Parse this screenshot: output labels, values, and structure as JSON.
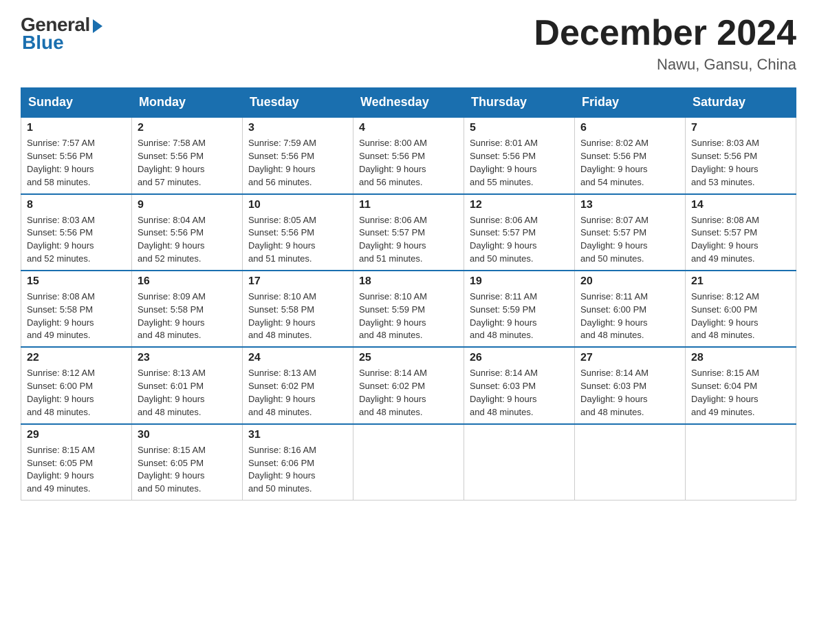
{
  "logo": {
    "general": "General",
    "blue": "Blue"
  },
  "header": {
    "title": "December 2024",
    "location": "Nawu, Gansu, China"
  },
  "weekdays": [
    "Sunday",
    "Monday",
    "Tuesday",
    "Wednesday",
    "Thursday",
    "Friday",
    "Saturday"
  ],
  "weeks": [
    [
      {
        "day": "1",
        "sunrise": "7:57 AM",
        "sunset": "5:56 PM",
        "daylight": "9 hours and 58 minutes."
      },
      {
        "day": "2",
        "sunrise": "7:58 AM",
        "sunset": "5:56 PM",
        "daylight": "9 hours and 57 minutes."
      },
      {
        "day": "3",
        "sunrise": "7:59 AM",
        "sunset": "5:56 PM",
        "daylight": "9 hours and 56 minutes."
      },
      {
        "day": "4",
        "sunrise": "8:00 AM",
        "sunset": "5:56 PM",
        "daylight": "9 hours and 56 minutes."
      },
      {
        "day": "5",
        "sunrise": "8:01 AM",
        "sunset": "5:56 PM",
        "daylight": "9 hours and 55 minutes."
      },
      {
        "day": "6",
        "sunrise": "8:02 AM",
        "sunset": "5:56 PM",
        "daylight": "9 hours and 54 minutes."
      },
      {
        "day": "7",
        "sunrise": "8:03 AM",
        "sunset": "5:56 PM",
        "daylight": "9 hours and 53 minutes."
      }
    ],
    [
      {
        "day": "8",
        "sunrise": "8:03 AM",
        "sunset": "5:56 PM",
        "daylight": "9 hours and 52 minutes."
      },
      {
        "day": "9",
        "sunrise": "8:04 AM",
        "sunset": "5:56 PM",
        "daylight": "9 hours and 52 minutes."
      },
      {
        "day": "10",
        "sunrise": "8:05 AM",
        "sunset": "5:56 PM",
        "daylight": "9 hours and 51 minutes."
      },
      {
        "day": "11",
        "sunrise": "8:06 AM",
        "sunset": "5:57 PM",
        "daylight": "9 hours and 51 minutes."
      },
      {
        "day": "12",
        "sunrise": "8:06 AM",
        "sunset": "5:57 PM",
        "daylight": "9 hours and 50 minutes."
      },
      {
        "day": "13",
        "sunrise": "8:07 AM",
        "sunset": "5:57 PM",
        "daylight": "9 hours and 50 minutes."
      },
      {
        "day": "14",
        "sunrise": "8:08 AM",
        "sunset": "5:57 PM",
        "daylight": "9 hours and 49 minutes."
      }
    ],
    [
      {
        "day": "15",
        "sunrise": "8:08 AM",
        "sunset": "5:58 PM",
        "daylight": "9 hours and 49 minutes."
      },
      {
        "day": "16",
        "sunrise": "8:09 AM",
        "sunset": "5:58 PM",
        "daylight": "9 hours and 48 minutes."
      },
      {
        "day": "17",
        "sunrise": "8:10 AM",
        "sunset": "5:58 PM",
        "daylight": "9 hours and 48 minutes."
      },
      {
        "day": "18",
        "sunrise": "8:10 AM",
        "sunset": "5:59 PM",
        "daylight": "9 hours and 48 minutes."
      },
      {
        "day": "19",
        "sunrise": "8:11 AM",
        "sunset": "5:59 PM",
        "daylight": "9 hours and 48 minutes."
      },
      {
        "day": "20",
        "sunrise": "8:11 AM",
        "sunset": "6:00 PM",
        "daylight": "9 hours and 48 minutes."
      },
      {
        "day": "21",
        "sunrise": "8:12 AM",
        "sunset": "6:00 PM",
        "daylight": "9 hours and 48 minutes."
      }
    ],
    [
      {
        "day": "22",
        "sunrise": "8:12 AM",
        "sunset": "6:00 PM",
        "daylight": "9 hours and 48 minutes."
      },
      {
        "day": "23",
        "sunrise": "8:13 AM",
        "sunset": "6:01 PM",
        "daylight": "9 hours and 48 minutes."
      },
      {
        "day": "24",
        "sunrise": "8:13 AM",
        "sunset": "6:02 PM",
        "daylight": "9 hours and 48 minutes."
      },
      {
        "day": "25",
        "sunrise": "8:14 AM",
        "sunset": "6:02 PM",
        "daylight": "9 hours and 48 minutes."
      },
      {
        "day": "26",
        "sunrise": "8:14 AM",
        "sunset": "6:03 PM",
        "daylight": "9 hours and 48 minutes."
      },
      {
        "day": "27",
        "sunrise": "8:14 AM",
        "sunset": "6:03 PM",
        "daylight": "9 hours and 48 minutes."
      },
      {
        "day": "28",
        "sunrise": "8:15 AM",
        "sunset": "6:04 PM",
        "daylight": "9 hours and 49 minutes."
      }
    ],
    [
      {
        "day": "29",
        "sunrise": "8:15 AM",
        "sunset": "6:05 PM",
        "daylight": "9 hours and 49 minutes."
      },
      {
        "day": "30",
        "sunrise": "8:15 AM",
        "sunset": "6:05 PM",
        "daylight": "9 hours and 50 minutes."
      },
      {
        "day": "31",
        "sunrise": "8:16 AM",
        "sunset": "6:06 PM",
        "daylight": "9 hours and 50 minutes."
      },
      null,
      null,
      null,
      null
    ]
  ],
  "labels": {
    "sunrise": "Sunrise:",
    "sunset": "Sunset:",
    "daylight": "Daylight:"
  }
}
